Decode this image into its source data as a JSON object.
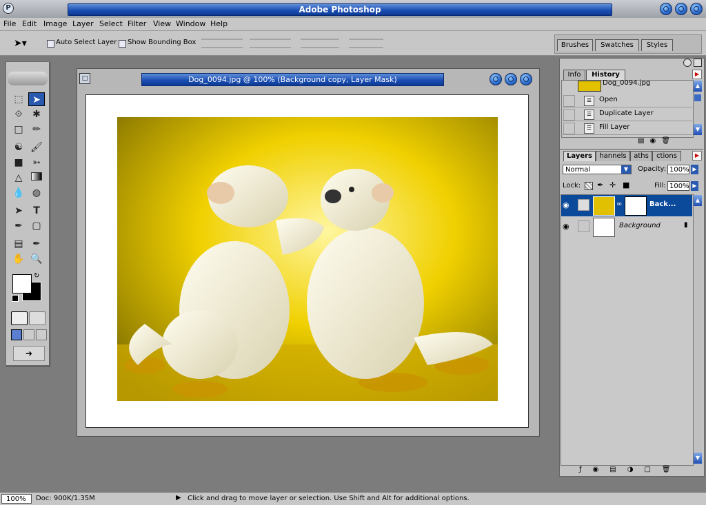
{
  "app": {
    "title": "Adobe Photoshop"
  },
  "menu": [
    "File",
    "Edit",
    "Image",
    "Layer",
    "Select",
    "Filter",
    "View",
    "Window",
    "Help"
  ],
  "options": {
    "auto_select_label": "Auto Select Layer",
    "bounding_box_label": "Show Bounding Box"
  },
  "wells": [
    "Brushes",
    "Swatches",
    "Styles"
  ],
  "document": {
    "title": "Dog_0094.jpg @ 100% (Background copy, Layer Mask)"
  },
  "history": {
    "tabs": [
      "Info",
      "History"
    ],
    "snapshot": "Dog_0094.jpg",
    "items": [
      "Open",
      "Duplicate Layer",
      "Fill Layer"
    ]
  },
  "layers": {
    "tabs": [
      "Layers",
      "Channels",
      "Paths",
      "Actions"
    ],
    "tab_visible": [
      "Layers",
      "hannels",
      "aths",
      "ctions"
    ],
    "blend_mode": "Normal",
    "opacity_label": "Opacity:",
    "opacity": "100%",
    "lock_label": "Lock:",
    "fill_label": "Fill:",
    "fill": "100%",
    "list": [
      {
        "name": "Back...",
        "selected": true
      },
      {
        "name": "Background",
        "selected": false
      }
    ]
  },
  "status": {
    "zoom": "100%",
    "doc": "Doc: 900K/1.35M",
    "hint": "Click and drag to move layer or selection.  Use Shift and Alt for additional options."
  },
  "colors": {
    "accent": "#0a3f8f",
    "selection": "#0b4a9a"
  }
}
